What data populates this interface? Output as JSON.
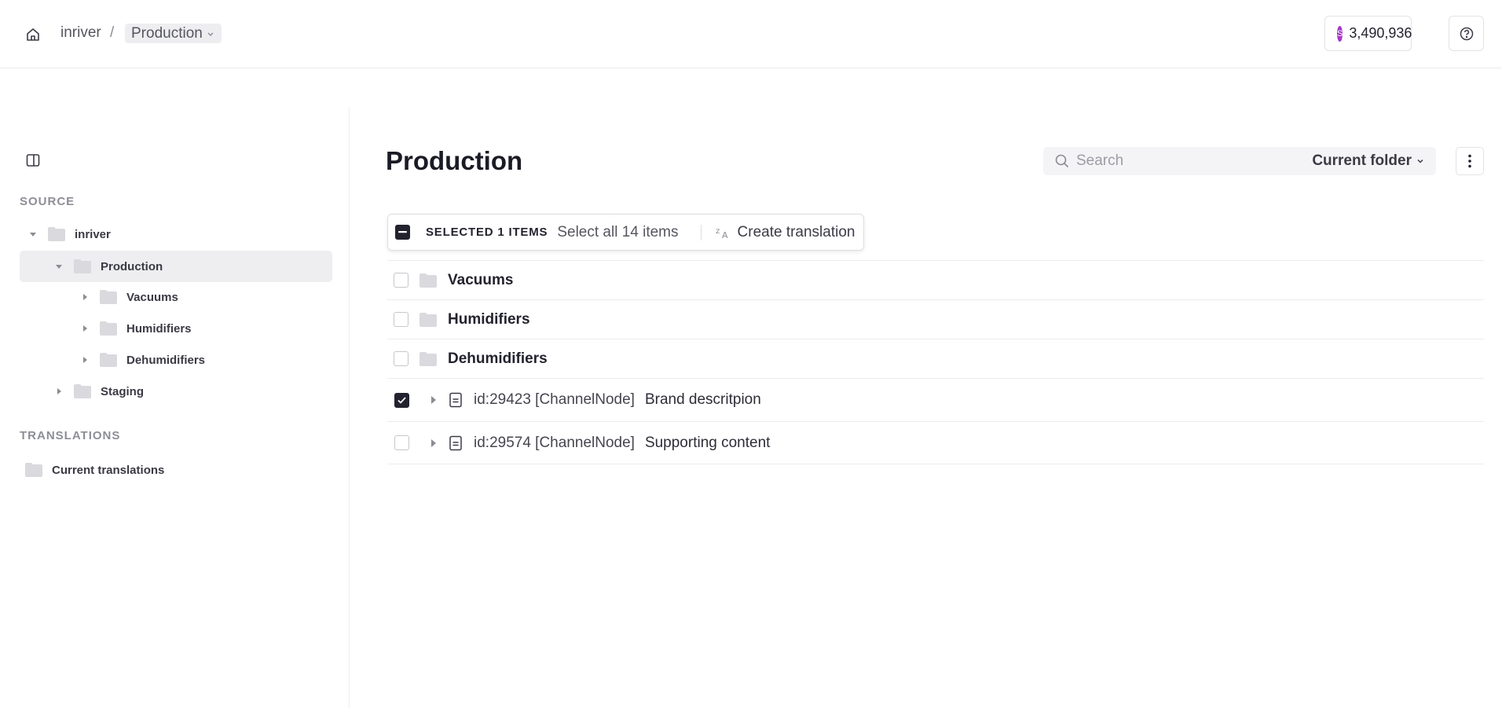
{
  "breadcrumb": {
    "root": "inriver",
    "separator": "/",
    "current": "Production"
  },
  "credits": {
    "icon_letter": "S",
    "value": "3,490,936"
  },
  "sidebar": {
    "source_title": "SOURCE",
    "tree": [
      {
        "label": "inriver",
        "expanded": true
      },
      {
        "label": "Production",
        "expanded": true,
        "selected": true
      },
      {
        "label": "Vacuums"
      },
      {
        "label": "Humidifiers"
      },
      {
        "label": "Dehumidifiers"
      },
      {
        "label": "Staging"
      }
    ],
    "translations_title": "TRANSLATIONS",
    "translations_item": "Current translations"
  },
  "main": {
    "title": "Production",
    "search_placeholder": "Search",
    "scope_label": "Current folder",
    "selection": {
      "count_label": "SELECTED 1 ITEMS",
      "select_all": "Select all 14 items",
      "action": "Create translation"
    },
    "folders": [
      "Vacuums",
      "Humidifiers",
      "Dehumidifiers"
    ],
    "documents": [
      {
        "id": "id:29423 [ChannelNode]",
        "title": "Brand descritpion",
        "checked": true
      },
      {
        "id": "id:29574 [ChannelNode]",
        "title": "Supporting content",
        "checked": false
      }
    ]
  },
  "colors": {
    "accent_dark": "#23232f",
    "coin": "#a637c9",
    "selected_bg": "#eeeef1"
  }
}
